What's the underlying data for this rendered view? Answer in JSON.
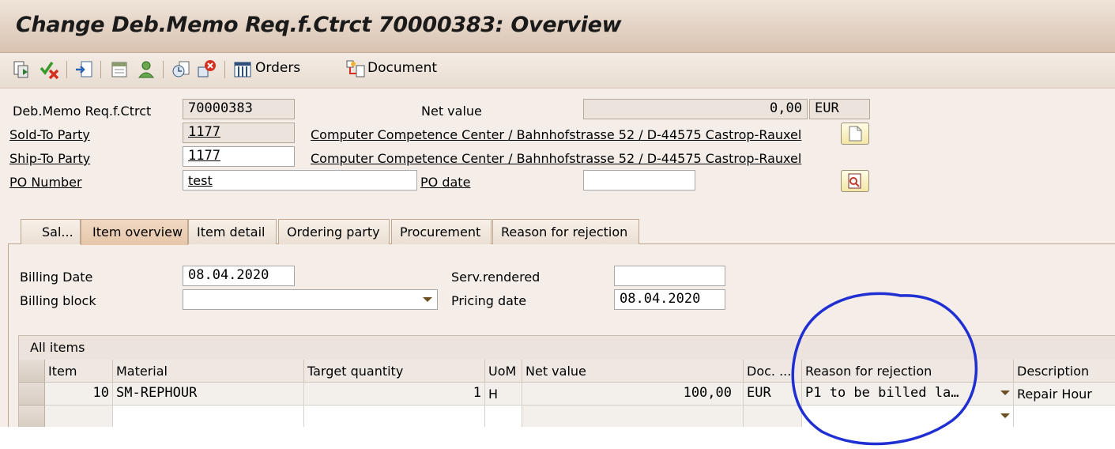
{
  "window": {
    "title": "Change Deb.Memo Req.f.Ctrct 70000383: Overview"
  },
  "toolbar": {
    "icons": [
      "display-icon",
      "check-icon",
      "import-icon",
      "header-icon",
      "partner-icon",
      "clock-icon",
      "delete-icon"
    ],
    "orders_label": "Orders",
    "document_label": "Document"
  },
  "header": {
    "doc_label": "Deb.Memo Req.f.Ctrct",
    "doc_value": "70000383",
    "net_value_label": "Net value",
    "net_value": "0,00",
    "currency": "EUR",
    "sold_to_label": "Sold-To Party",
    "sold_to_value": "1177",
    "sold_to_address": "Computer Competence Center / Bahnhofstrasse 52 / D-44575 Castrop-Rauxel",
    "ship_to_label": "Ship-To Party",
    "ship_to_value": "1177",
    "ship_to_address": "Computer Competence Center / Bahnhofstrasse 52 / D-44575 Castrop-Rauxel",
    "po_number_label": "PO Number",
    "po_number_value": "test",
    "po_date_label": "PO date",
    "po_date_value": ""
  },
  "tabs": [
    {
      "label": "Sal..."
    },
    {
      "label": "Item overview",
      "active": true
    },
    {
      "label": "Item detail"
    },
    {
      "label": "Ordering party"
    },
    {
      "label": "Procurement"
    },
    {
      "label": "Reason for rejection"
    }
  ],
  "item_overview": {
    "billing_date_label": "Billing Date",
    "billing_date_value": "08.04.2020",
    "billing_block_label": "Billing block",
    "billing_block_value": "",
    "serv_rendered_label": "Serv.rendered",
    "serv_rendered_value": "",
    "pricing_date_label": "Pricing date",
    "pricing_date_value": "08.04.2020"
  },
  "items_table": {
    "title": "All items",
    "columns": [
      "Item",
      "Material",
      "Target quantity",
      "UoM",
      "Net value",
      "Doc. ...",
      "Reason for rejection",
      "Description"
    ],
    "rows": [
      {
        "item": "10",
        "material": "SM-REPHOUR",
        "target_quantity": "1",
        "uom": "H",
        "net_value": "100,00",
        "doc_currency": "EUR",
        "reason_for_rejection": "P1 to be billed la…",
        "description": "Repair Hour"
      },
      {
        "item": "",
        "material": "",
        "target_quantity": "",
        "uom": "",
        "net_value": "",
        "doc_currency": "",
        "reason_for_rejection": "",
        "description": ""
      }
    ]
  },
  "colors": {
    "title_bar": "#d9c3b1",
    "annotation_circle": "#1f2fd1",
    "form_background": "#f5eee8"
  }
}
